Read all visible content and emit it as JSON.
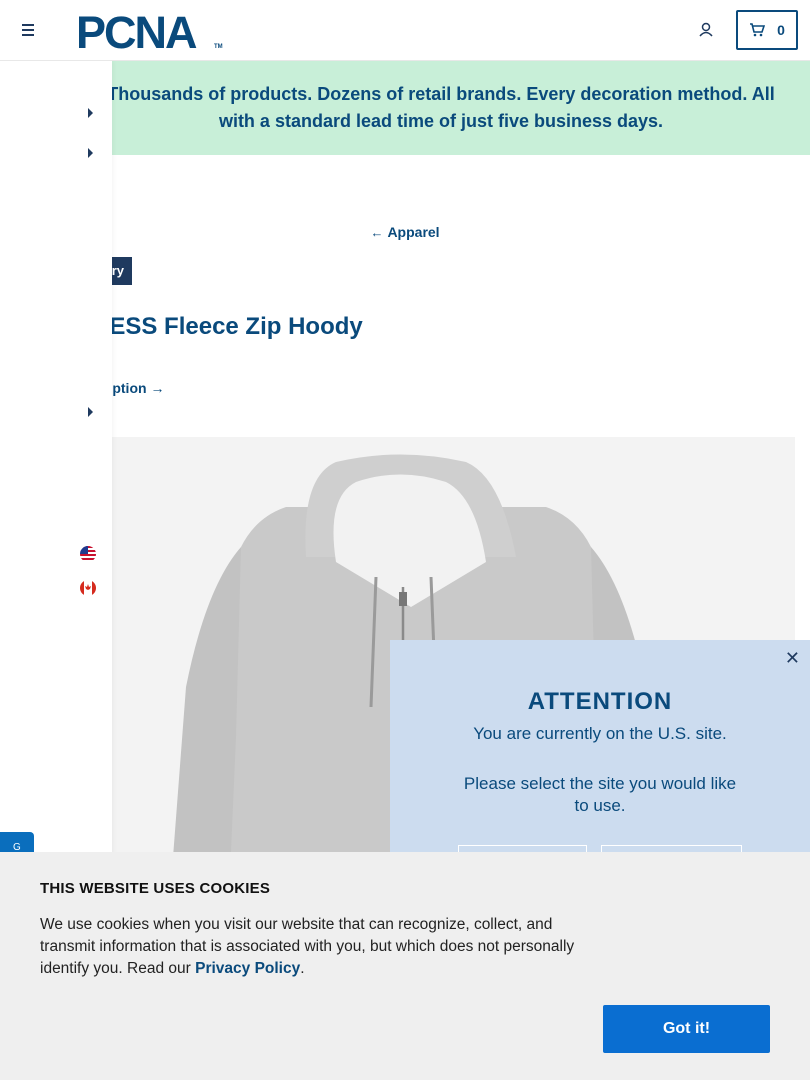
{
  "header": {
    "logo_text": "PCNA",
    "logo_tm": "TM",
    "cart_count": "0"
  },
  "banner": {
    "line1": "Thousands of products. Dozens of retail brands. Every decoration method. All",
    "line2": "with a standard lead time of just five business days."
  },
  "breadcrumb": {
    "back_label": "Apparel"
  },
  "product": {
    "badge": "ry",
    "title": "YPRESS Fleece Zip Hoody",
    "alt_option": "men's option"
  },
  "attention_modal": {
    "title": "ATTENTION",
    "line1": "You are currently on the U.S. site.",
    "line2": "Please select the site you would like to use."
  },
  "cookie_banner": {
    "title": "THIS WEBSITE USES COOKIES",
    "text": "We use cookies when you visit our website that can recognize, collect, and transmit information that is associated with you, but which does not personally identify you. Read our",
    "link": "Privacy Policy",
    "period": ".",
    "accept_label": "Got it!"
  },
  "feedback_tab": {
    "label": "G"
  },
  "colors": {
    "brand_blue": "#0a4a7c",
    "banner_green": "#c8efd8",
    "modal_blue": "#ccdcef",
    "button_blue": "#0a6ed1",
    "hoodie_grey": "#c9c9c9"
  }
}
